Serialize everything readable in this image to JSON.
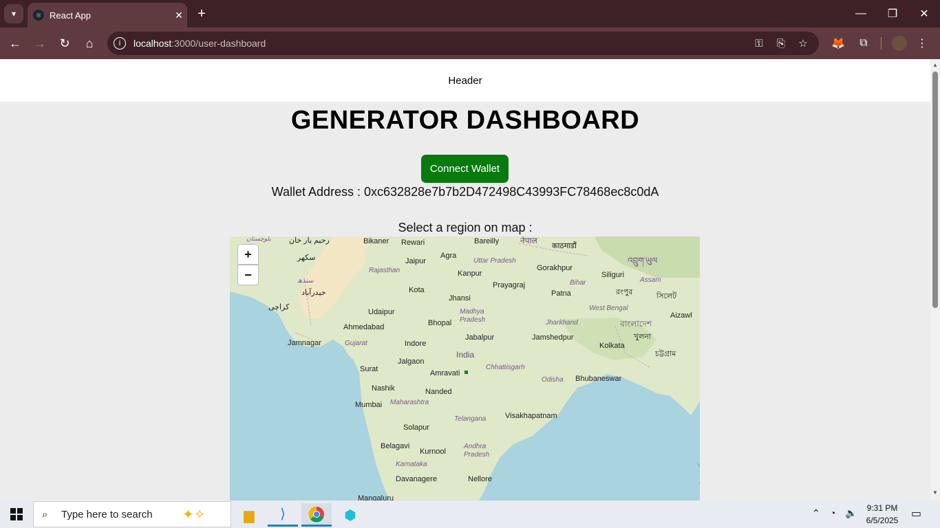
{
  "browser": {
    "tab_title": "React App",
    "url_host": "localhost",
    "url_path": ":3000/user-dashboard"
  },
  "page": {
    "header": "Header",
    "title": "GENERATOR DASHBOARD",
    "connect_button": "Connect Wallet",
    "wallet_address": "Wallet Address : 0xc632828e7b7b2D472498C43993FC78468ec8c0dA",
    "select_label": "Select a region on map :"
  },
  "map": {
    "zoom_in": "+",
    "zoom_out": "−",
    "labels": {
      "bikaner": "Bikaner",
      "rewari": "Rewari",
      "bareilly": "Bareilly",
      "nepal": "नेपाल",
      "kathmandu": "काठमाडौं",
      "jaipur": "Jaipur",
      "agra": "Agra",
      "uttar_pradesh": "Uttar Pradesh",
      "gorakhpur": "Gorakhpur",
      "rajasthan": "Rajasthan",
      "kanpur": "Kanpur",
      "siliguri": "Siliguri",
      "assam": "Assam",
      "kota": "Kota",
      "prayagraj": "Prayagraj",
      "bihar": "Bihar",
      "jhansi": "Jhansi",
      "patna": "Patna",
      "udaipur": "Udaipur",
      "madhya_pradesh": "Madhya Pradesh",
      "jharkhand": "Jharkhand",
      "west_bengal": "West Bengal",
      "aizawl": "Aizawl",
      "ahmedabad": "Ahmedabad",
      "bhopal": "Bhopal",
      "jamnagar": "Jamnagar",
      "indore": "Indore",
      "jabalpur": "Jabalpur",
      "jamshedpur": "Jamshedpur",
      "kolkata": "Kolkata",
      "gujarat": "Gujarat",
      "india": "India",
      "jalgaon": "Jalgaon",
      "surat": "Surat",
      "amravati": "Amravati",
      "chhattisgarh": "Chhattisgarh",
      "odisha": "Odisha",
      "bhubaneswar": "Bhubaneswar",
      "nashik": "Nashik",
      "nanded": "Nanded",
      "mumbai": "Mumbai",
      "maharashtra": "Maharashtra",
      "telangana": "Telangana",
      "visakhapatnam": "Visakhapatnam",
      "solapur": "Solapur",
      "belagavi": "Belagavi",
      "kurnool": "Kurnool",
      "andhra_pradesh": "Andhra Pradesh",
      "karnataka": "Karnataka",
      "davanagere": "Davanagere",
      "nellore": "Nellore",
      "mangaluru": "Mangaluru",
      "karachi": "کراچی",
      "hyderabad_pk": "حيدرآباد",
      "sukkur": "سکھر",
      "sindh": "سندھ",
      "rahim_yar_khan": "رحيم يار خان",
      "balochistan": "بلوچستان",
      "bangladesh": "বাংলাদেশ",
      "khulna": "খুলনা",
      "chattogram": "চট্টগ্রাম",
      "sylhet": "সিলেট",
      "rangpur": "রংপুর",
      "bhutan": "འབྲུག་ཡུལ"
    }
  },
  "taskbar": {
    "search_placeholder": "Type here to search",
    "time": "9:31 PM",
    "date": "6/5/2025"
  },
  "colors": {
    "browser_frame": "#3d2126",
    "toolbar": "#5f3b40",
    "button_green": "#0a7a0f",
    "page_bg": "#ececec",
    "water": "#a9d3de",
    "land": "#dfe8c8"
  }
}
